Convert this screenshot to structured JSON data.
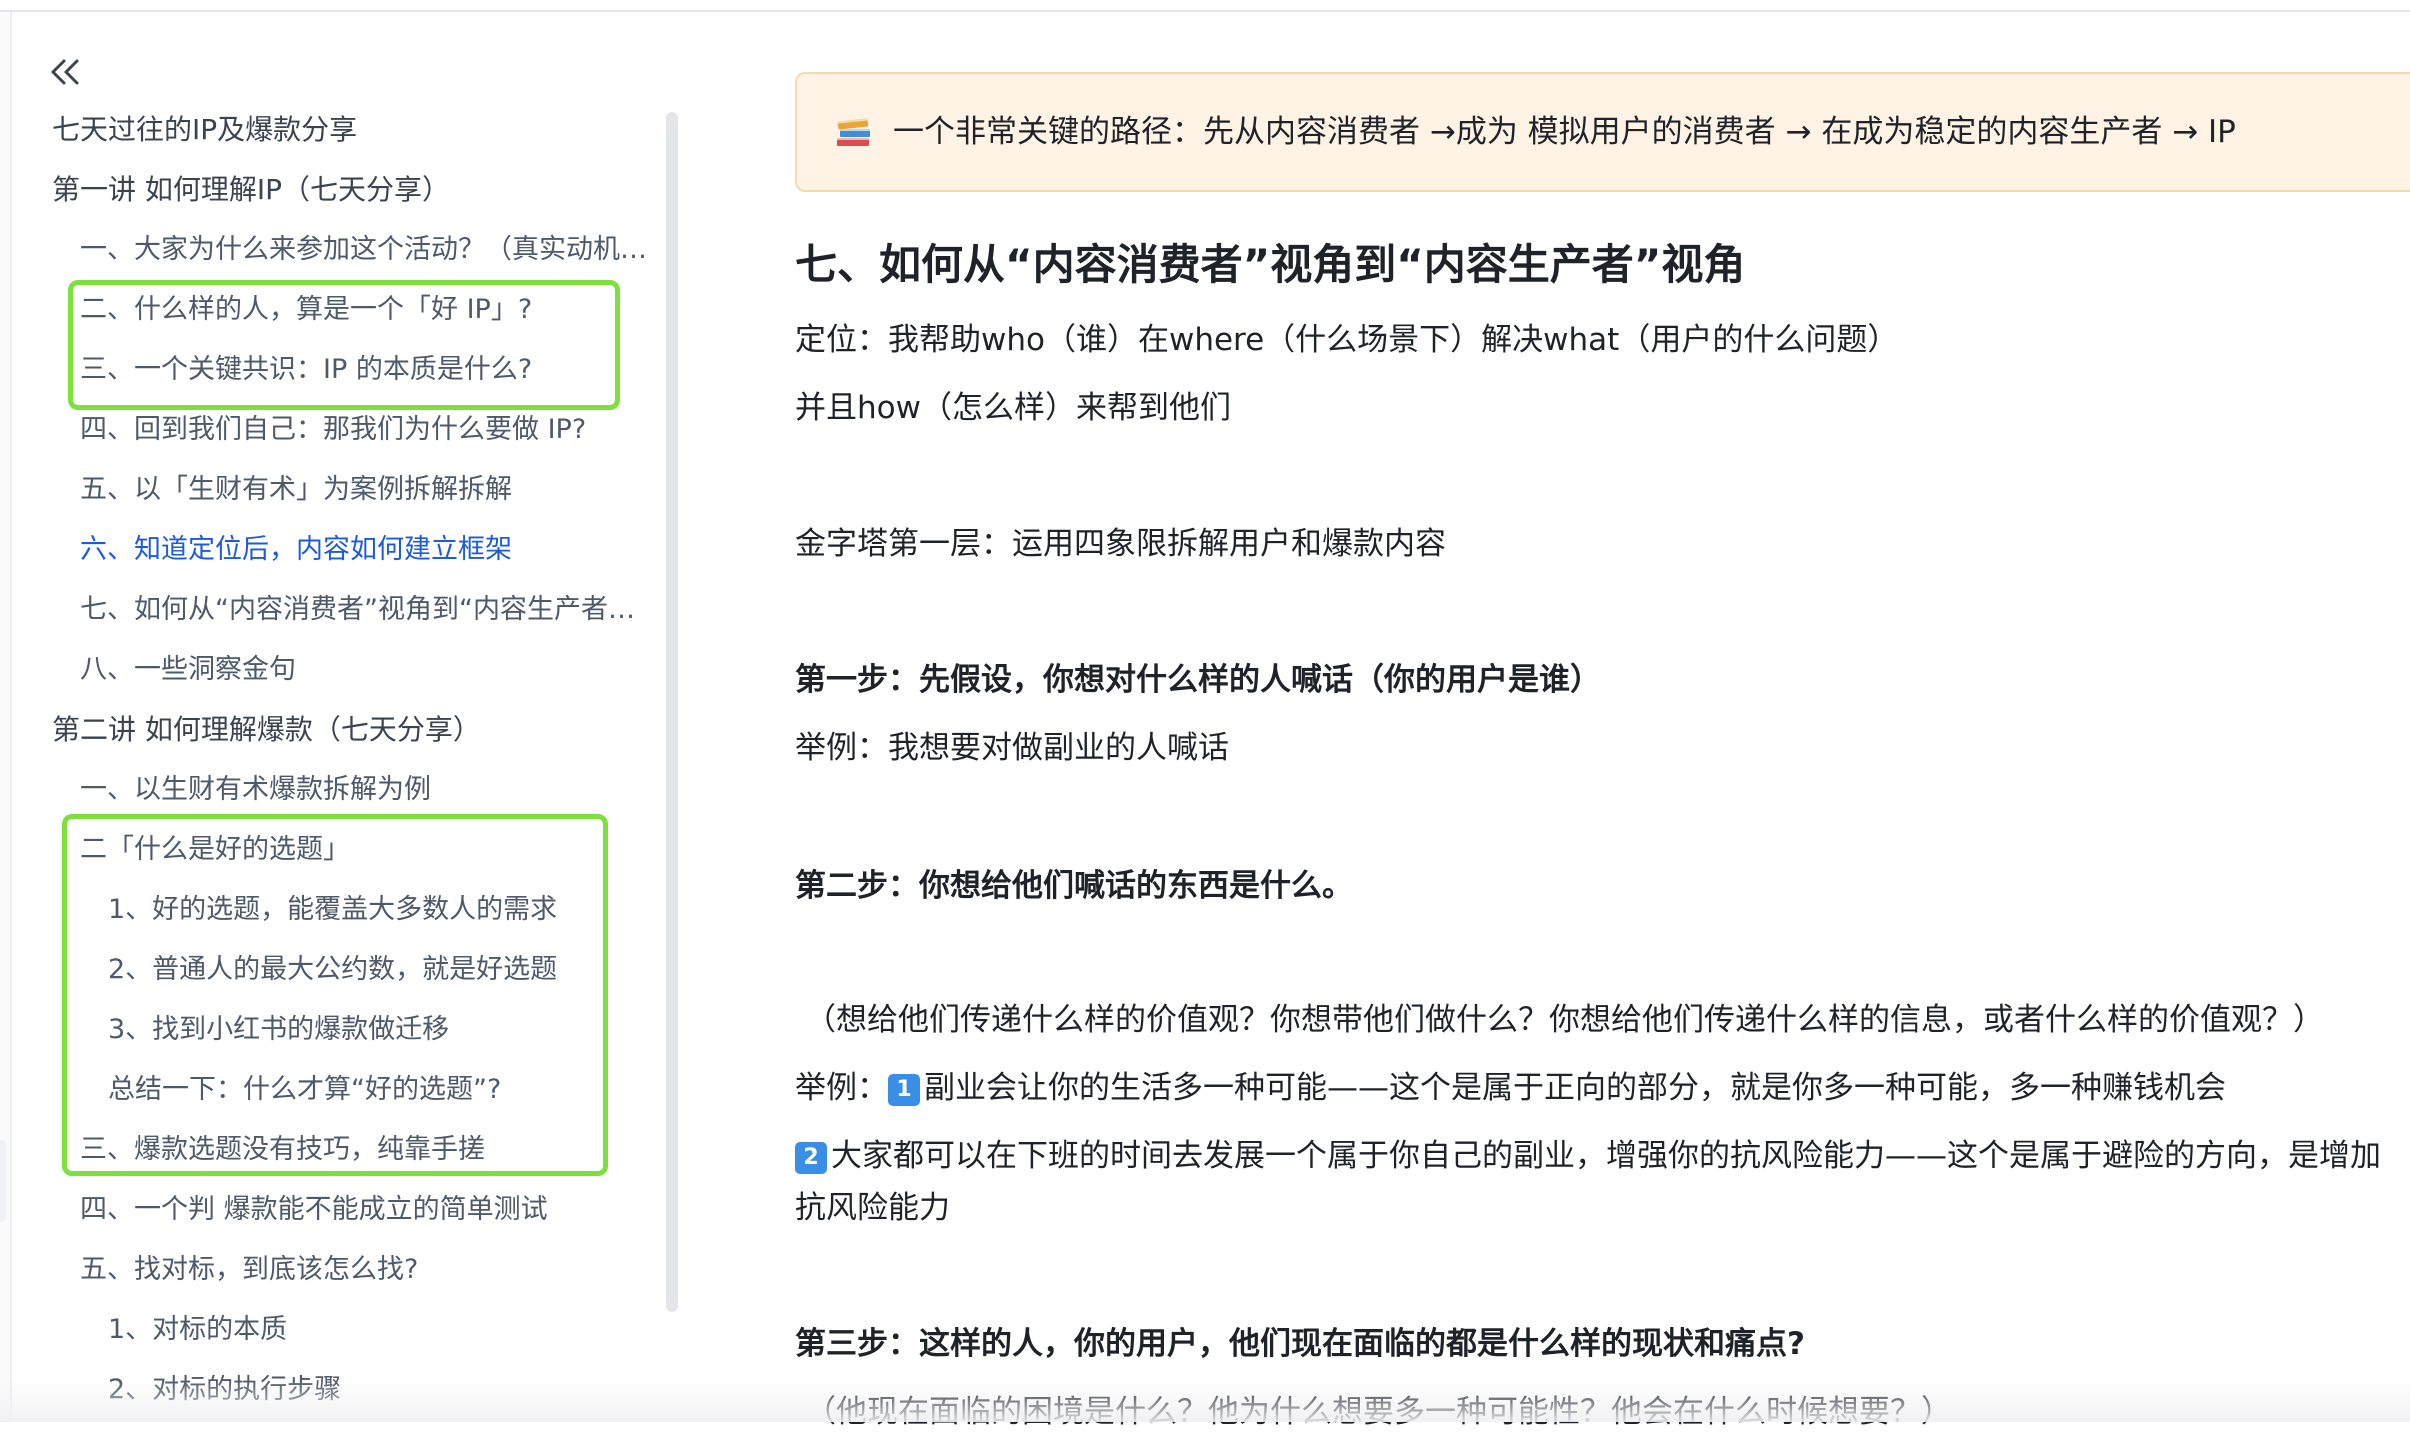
{
  "toc": {
    "collapse_icon": "double-chevron-left-icon",
    "items": [
      {
        "label": "七天过往的IP及爆款分享",
        "level": 0
      },
      {
        "label": "第一讲 如何理解IP（七天分享）",
        "level": 0
      },
      {
        "label": "一、大家为什么来参加这个活动？（真实动机…",
        "level": 1
      },
      {
        "label": "二、什么样的人，算是一个「好 IP」?",
        "level": 1
      },
      {
        "label": "三、一个关键共识：IP 的本质是什么?",
        "level": 1
      },
      {
        "label": "四、回到我们自己：那我们为什么要做 IP?",
        "level": 1
      },
      {
        "label": "五、以「生财有术」为案例拆解拆解",
        "level": 1
      },
      {
        "label": "六、知道定位后，内容如何建立框架",
        "level": 1,
        "active": true
      },
      {
        "label": "七、如何从“内容消费者”视角到“内容生产者…",
        "level": 1
      },
      {
        "label": "八、一些洞察金句",
        "level": 1
      },
      {
        "label": "第二讲 如何理解爆款（七天分享）",
        "level": 0
      },
      {
        "label": "一、以生财有术爆款拆解为例",
        "level": 1
      },
      {
        "label": "二「什么是好的选题」",
        "level": 1
      },
      {
        "label": "1、好的选题，能覆盖大多数人的需求",
        "level": 2
      },
      {
        "label": "2、普通人的最大公约数，就是好选题",
        "level": 2
      },
      {
        "label": "3、找到小红书的爆款做迁移",
        "level": 2
      },
      {
        "label": "总结一下：什么才算“好的选题”?",
        "level": 2
      },
      {
        "label": "三、爆款选题没有技巧，纯靠手搓",
        "level": 1
      },
      {
        "label": "四、一个判 爆款能不能成立的简单测试",
        "level": 1
      },
      {
        "label": "五、找对标，到底该怎么找?",
        "level": 1
      },
      {
        "label": "1、对标的本质",
        "level": 2
      },
      {
        "label": "2、对标的执行步骤",
        "level": 2
      }
    ],
    "active_color": "#1d5bd8",
    "highlight_color": "#7ee03c"
  },
  "content": {
    "callout": {
      "icon": "books-icon",
      "text": "一个非常关键的路径：先从内容消费者 →成为 模拟用户的消费者 → 在成为稳定的内容生产者 → IP"
    },
    "heading": "七、如何从“内容消费者”视角到“内容生产者”视角",
    "paragraphs": {
      "p1": "定位：我帮助who（谁）在where（什么场景下）解决what（用户的什么问题）",
      "p2": "并且how（怎么样）来帮到他们",
      "p3": "金字塔第一层：运用四象限拆解用户和爆款内容",
      "step1": "第一步：先假设，你想对什么样的人喊话（你的用户是谁）",
      "ex1": "举例：我想要对做副业的人喊话",
      "step2": "第二步：你想给他们喊话的东西是什么。",
      "q2": "（想给他们传递什么样的价值观？你想带他们做什么？你想给他们传递什么样的信息，或者什么样的价值观？）",
      "ex2_prefix": "举例：",
      "badge1": "1",
      "ex2_text": "副业会让你的生活多一种可能——这个是属于正向的部分，就是你多一种可能，多一种赚钱机会",
      "badge2": "2",
      "ex3_text": "大家都可以在下班的时间去发展一个属于你自己的副业，增强你的抗风险能力——这个是属于避险的方向，是增加",
      "ex3_cont": "抗风险能力",
      "step3": "第三步：这样的人，你的用户，他们现在面临的都是什么样的现状和痛点?",
      "q3": "（他现在面临的困境是什么？他为什么想要多一种可能性？他会在什么时候想要？）"
    }
  }
}
